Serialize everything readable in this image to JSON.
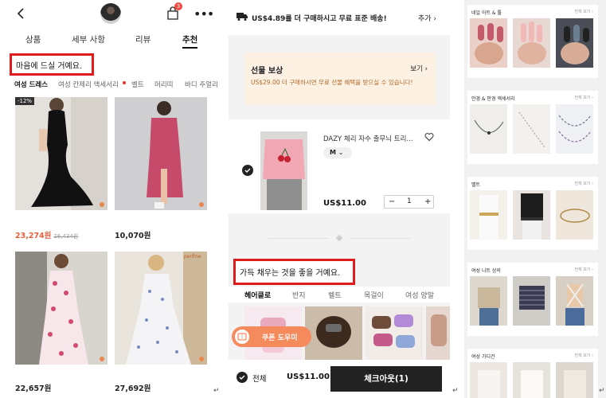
{
  "p1": {
    "cart_count": "3",
    "tabs": [
      "상품",
      "세부 사항",
      "리뷰",
      "추천"
    ],
    "callout": "마음에 드실 거예요.",
    "categories": [
      "여성 드레스",
      "여성 칸제리 액세서리",
      "벨트",
      "머리띠",
      "바디 주얼리"
    ],
    "products": [
      {
        "price": "23,274원",
        "orig": "26,434원",
        "discount": "-12%"
      },
      {
        "price": "10,070원"
      },
      {
        "price": "22,657원"
      },
      {
        "price": "27,692원",
        "brand": "perfme"
      }
    ]
  },
  "p2": {
    "shipping": "US$4.89를 더 구매하시고 무료 표준 배송!",
    "shipping_add": "추가",
    "gift_title": "선물 보상",
    "gift_view": "보기",
    "gift_desc": "US$29.00 더 구매하시면 무료 선물 혜택을 받으실 수 있습니다!",
    "item_name": "DAZY 체리 자수 출무늬 트리...",
    "item_size": "M",
    "item_price": "US$11.00",
    "item_qty": "1",
    "callout": "가득 채우는 것을 좋을 거예요.",
    "rec_tabs": [
      "헤어클로",
      "반지",
      "벨트",
      "목걸이",
      "여성 양말"
    ],
    "coupon": "쿠폰 도우미",
    "all_label": "전체",
    "total": "US$11.00",
    "checkout": "체크아웃(1)"
  },
  "p3": {
    "more": "전체 보기",
    "sections": [
      "네일 아트 & 툴",
      "안경 & 안경 액세서리",
      "벨트",
      "여성 니트 상의",
      "여성 가디건"
    ]
  },
  "colors": {
    "callout_border": "#e01b1b",
    "badge": "#f2473a",
    "price_sale": "#e8613c",
    "coupon": "#f58a5c"
  }
}
